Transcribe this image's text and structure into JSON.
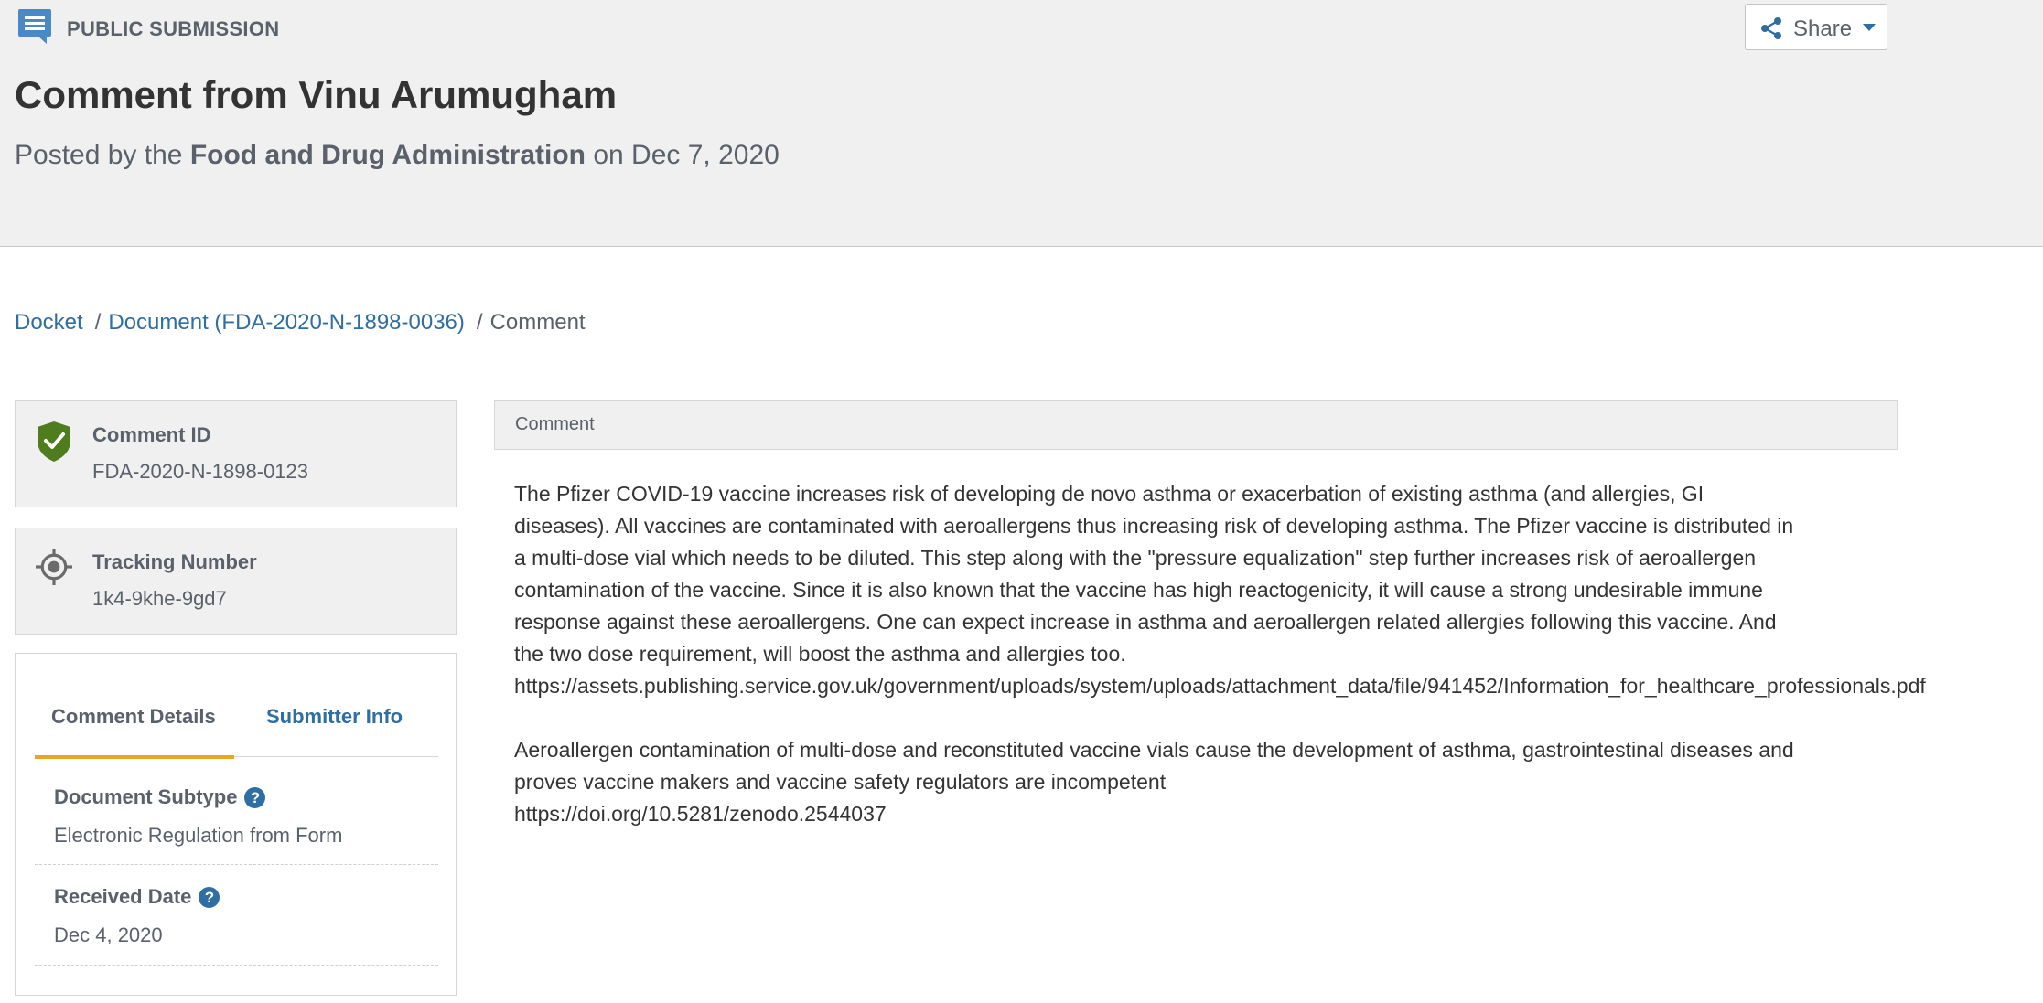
{
  "header": {
    "section_label": "PUBLIC SUBMISSION",
    "share_label": "Share",
    "title": "Comment from Vinu Arumugham",
    "posted_prefix": "Posted by the",
    "agency": "Food and Drug Administration",
    "posted_suffix": "on Dec 7, 2020"
  },
  "breadcrumb": {
    "docket": "Docket",
    "document": "Document (FDA-2020-N-1898-0036)",
    "current": "Comment",
    "separator": "/"
  },
  "sidebar": {
    "comment_id": {
      "label": "Comment ID",
      "value": "FDA-2020-N-1898-0123",
      "icon": "verified-shield-icon"
    },
    "tracking": {
      "label": "Tracking Number",
      "value": "1k4-9khe-9gd7",
      "icon": "target-icon"
    },
    "tabs": [
      {
        "label": "Comment Details",
        "active": true
      },
      {
        "label": "Submitter Info",
        "active": false
      }
    ],
    "fields": [
      {
        "label": "Document Subtype",
        "value": "Electronic Regulation from Form"
      },
      {
        "label": "Received Date",
        "value": "Dec 4, 2020"
      }
    ],
    "help_glyph": "?"
  },
  "comment": {
    "heading": "Comment",
    "paragraph1": [
      "The Pfizer COVID-19 vaccine increases risk of developing de novo asthma or exacerbation of existing asthma (and allergies, GI",
      "diseases). All vaccines are contaminated with aeroallergens thus increasing risk of developing asthma. The Pfizer vaccine is distributed in",
      "a multi-dose vial which needs to be diluted. This step along with the \"pressure equalization\" step further increases risk of aeroallergen",
      "contamination of the vaccine. Since it is also known that the vaccine has high reactogenicity, it will cause a strong undesirable immune",
      "response against these aeroallergens. One can expect increase in asthma and aeroallergen related allergies following this vaccine. And",
      "the two dose requirement, will boost the asthma and allergies too.",
      "https://assets.publishing.service.gov.uk/government/uploads/system/uploads/attachment_data/file/941452/Information_for_healthcare_professionals.pdf"
    ],
    "paragraph2": [
      "Aeroallergen contamination of multi-dose and reconstituted vaccine vials cause the development of asthma, gastrointestinal diseases and",
      "proves vaccine makers and vaccine safety regulators are incompetent",
      "https://doi.org/10.5281/zenodo.2544037"
    ]
  },
  "colors": {
    "header_bg": "#f0f0f0",
    "link": "#2f6ea3",
    "tab_accent": "#e5a823",
    "verified_green": "#4f7c1c",
    "icon_blue": "#4a8ac4"
  }
}
